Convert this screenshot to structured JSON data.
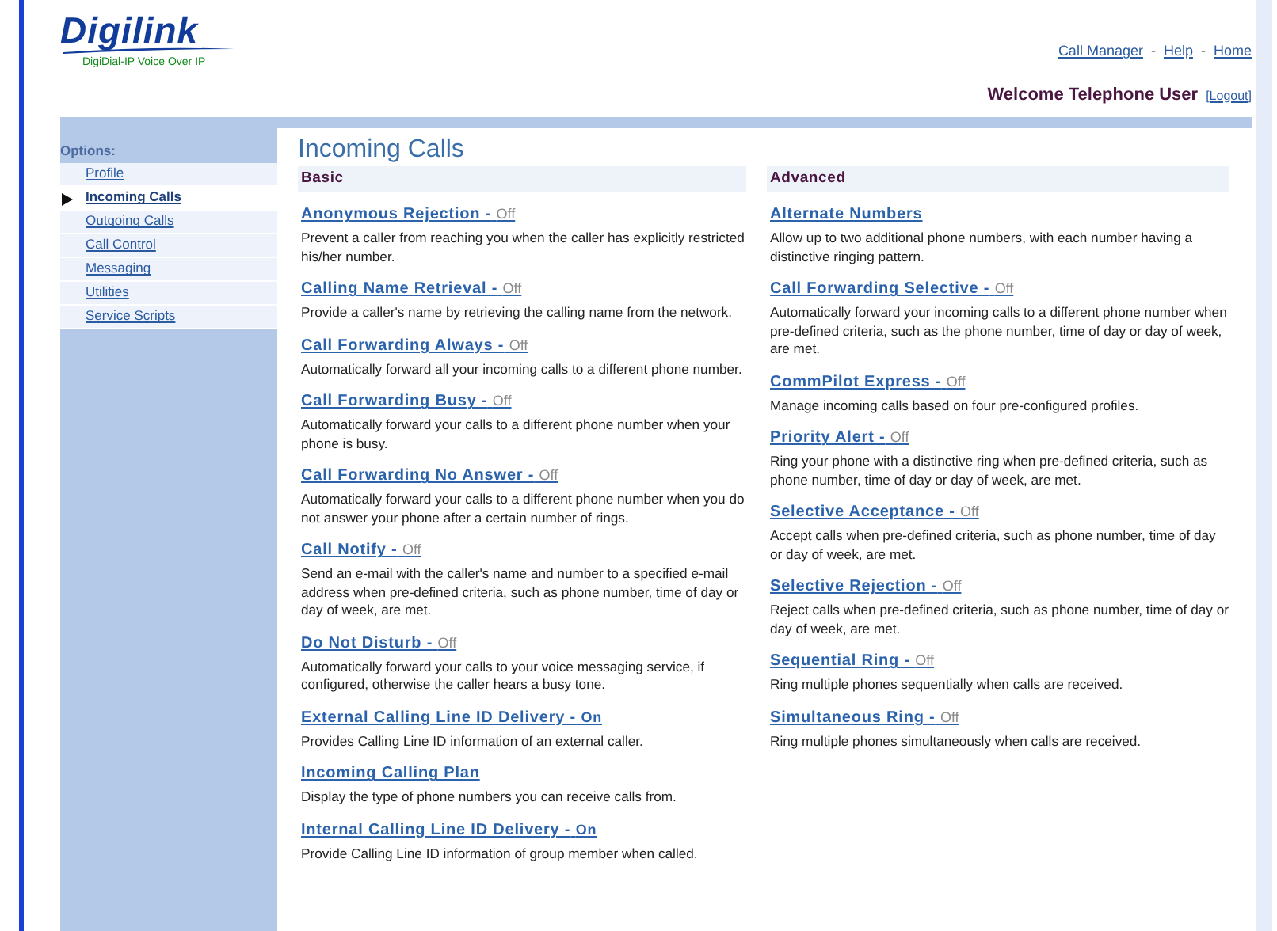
{
  "logo": {
    "name": "Digilink",
    "tagline": "DigiDial-IP Voice Over IP"
  },
  "top_nav": [
    {
      "kind": "link",
      "label": "Call Manager"
    },
    {
      "kind": "separator",
      "label": "-"
    },
    {
      "kind": "link",
      "label": "Help"
    },
    {
      "kind": "separator",
      "label": "-"
    },
    {
      "kind": "link",
      "label": "Home"
    }
  ],
  "welcome": "Welcome Telephone User",
  "logout": "[Logout]",
  "sidebar": {
    "heading": "Options:",
    "items": [
      {
        "label": "Profile",
        "selected": false
      },
      {
        "label": "Incoming Calls",
        "selected": true
      },
      {
        "label": "Outgoing Calls",
        "selected": false
      },
      {
        "label": "Call Control",
        "selected": false
      },
      {
        "label": "Messaging",
        "selected": false
      },
      {
        "label": "Utilities",
        "selected": false
      },
      {
        "label": "Service Scripts",
        "selected": false
      }
    ]
  },
  "page_title": "Incoming Calls",
  "columns": [
    {
      "heading": "Basic",
      "services": [
        {
          "title": "Anonymous Rejection -",
          "status": "Off",
          "on": false,
          "description": "Prevent a caller from reaching you when the caller has explicitly restricted his/her number."
        },
        {
          "title": "Calling Name Retrieval -",
          "status": "Off",
          "on": false,
          "description": "Provide a caller's name by retrieving the calling name from the network."
        },
        {
          "title": "Call Forwarding Always -",
          "status": "Off",
          "on": false,
          "description": "Automatically forward all your incoming calls to a different phone number."
        },
        {
          "title": "Call Forwarding Busy -",
          "status": "Off",
          "on": false,
          "description": "Automatically forward your calls to a different phone number when your phone is busy."
        },
        {
          "title": "Call Forwarding No Answer -",
          "status": "Off",
          "on": false,
          "description": "Automatically forward your calls to a different phone number when you do not answer your phone after a certain number of rings."
        },
        {
          "title": "Call Notify -",
          "status": "Off",
          "on": false,
          "description": "Send an e-mail with the caller's name and number to a specified e-mail address when pre-defined criteria, such as phone number, time of day or day of week, are met."
        },
        {
          "title": "Do Not Disturb -",
          "status": "Off",
          "on": false,
          "description": "Automatically forward your calls to your voice messaging service, if configured, otherwise the caller hears a busy tone."
        },
        {
          "title": "External Calling Line ID Delivery -",
          "status": "On",
          "on": true,
          "description": "Provides Calling Line ID information of an external caller."
        },
        {
          "title": "Incoming Calling Plan",
          "description": "Display the type of phone numbers you can receive calls from."
        },
        {
          "title": "Internal Calling Line ID Delivery -",
          "status": "On",
          "on": true,
          "description": "Provide Calling Line ID information of group member when called."
        }
      ]
    },
    {
      "heading": "Advanced",
      "services": [
        {
          "title": "Alternate Numbers",
          "description": "Allow up to two additional phone numbers, with each number having a distinctive ringing pattern."
        },
        {
          "title": "Call Forwarding Selective -",
          "status": "Off",
          "on": false,
          "description": "Automatically forward your incoming calls to a different phone number when pre-defined criteria, such as the phone number, time of day or day of week, are met."
        },
        {
          "title": "CommPilot Express -",
          "status": "Off",
          "on": false,
          "description": "Manage incoming calls based on four pre-configured profiles."
        },
        {
          "title": "Priority Alert -",
          "status": "Off",
          "on": false,
          "description": "Ring your phone with a distinctive ring when pre-defined criteria, such as phone number, time of day or day of week, are met."
        },
        {
          "title": "Selective Acceptance -",
          "status": "Off",
          "on": false,
          "description": "Accept calls when pre-defined criteria, such as phone number, time of day or day of week, are met."
        },
        {
          "title": "Selective Rejection -",
          "status": "Off",
          "on": false,
          "description": "Reject calls when pre-defined criteria, such as phone number, time of day or day of week, are met."
        },
        {
          "title": "Sequential Ring -",
          "status": "Off",
          "on": false,
          "description": "Ring multiple phones sequentially when calls are received."
        },
        {
          "title": "Simultaneous Ring -",
          "status": "Off",
          "on": false,
          "description": "Ring multiple phones simultaneously when calls are received."
        }
      ]
    }
  ]
}
